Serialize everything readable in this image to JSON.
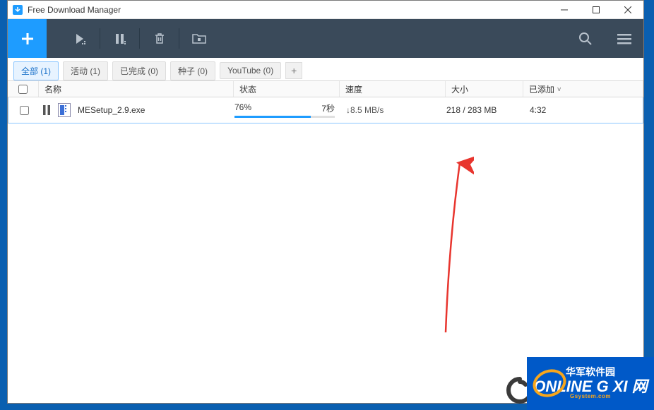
{
  "titlebar": {
    "title": "Free Download Manager"
  },
  "tabs": [
    {
      "label": "全部 (1)",
      "active": true
    },
    {
      "label": "活动 (1)",
      "active": false
    },
    {
      "label": "已完成 (0)",
      "active": false
    },
    {
      "label": "种子 (0)",
      "active": false
    },
    {
      "label": "YouTube (0)",
      "active": false
    }
  ],
  "headers": {
    "name": "名称",
    "status": "状态",
    "speed": "速度",
    "size": "大小",
    "added": "已添加"
  },
  "rows": [
    {
      "name": "MESetup_2.9.exe",
      "progress_pct": "76%",
      "eta": "7秒",
      "progress_fill": 76,
      "speed": "↓8.5 MB/s",
      "size": "218 / 283 MB",
      "added": "4:32"
    }
  ],
  "watermark": {
    "top": "华军软件园",
    "main": "ONLINE G XI 网",
    "sub": "Gsystem.com"
  }
}
